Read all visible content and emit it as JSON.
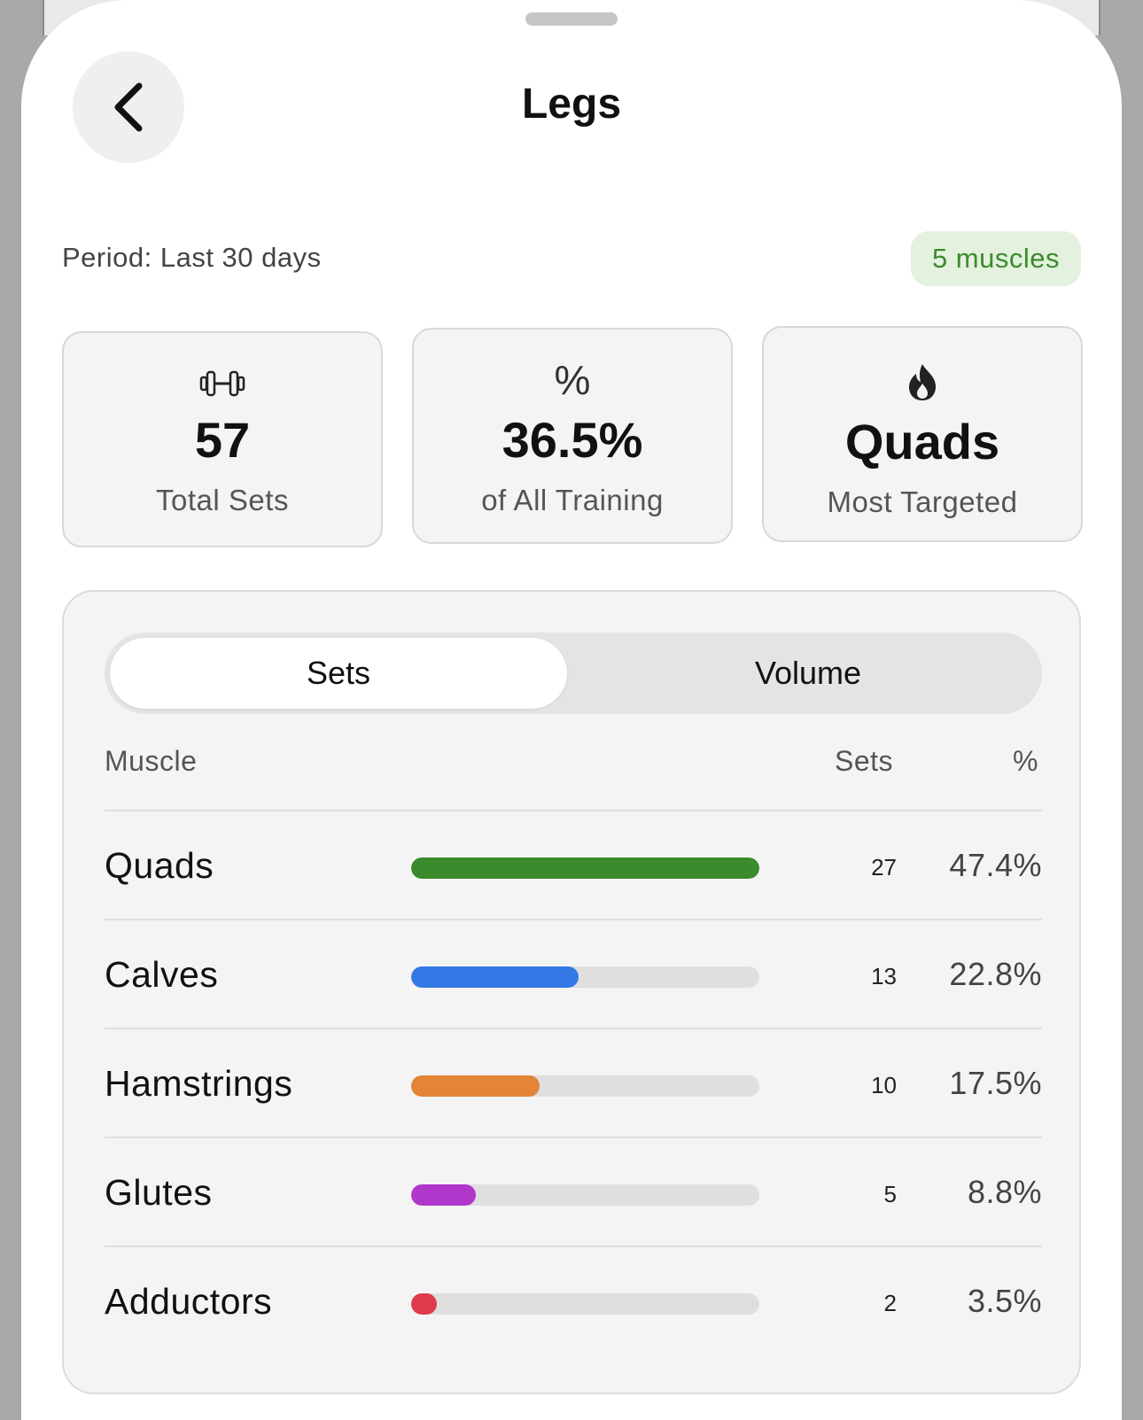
{
  "header": {
    "title": "Legs",
    "back_icon": "chevron-left-icon"
  },
  "summary": {
    "period": "Period: Last 30 days",
    "muscle_count_badge": "5 muscles",
    "badge_color": "#3b8b2c",
    "badge_bg": "#e3f1de"
  },
  "stats": [
    {
      "icon": "dumbbell-icon",
      "value": "57",
      "label": "Total Sets"
    },
    {
      "icon": "percent-icon",
      "icon_glyph": "%",
      "value": "36.5%",
      "label": "of All Training"
    },
    {
      "icon": "flame-icon",
      "value": "Quads",
      "label": "Most Targeted"
    }
  ],
  "toggle": {
    "options": [
      "Sets",
      "Volume"
    ],
    "selected": "Sets"
  },
  "table": {
    "columns": {
      "muscle": "Muscle",
      "sets": "Sets",
      "pct": "%"
    },
    "rows": [
      {
        "name": "Quads",
        "sets": "27",
        "pct": "47.4%",
        "bar_fraction": 1.0,
        "color": "#3b8a2c"
      },
      {
        "name": "Calves",
        "sets": "13",
        "pct": "22.8%",
        "bar_fraction": 0.481,
        "color": "#3478e5"
      },
      {
        "name": "Hamstrings",
        "sets": "10",
        "pct": "17.5%",
        "bar_fraction": 0.37,
        "color": "#e38436"
      },
      {
        "name": "Glutes",
        "sets": "5",
        "pct": "8.8%",
        "bar_fraction": 0.185,
        "color": "#b037cc"
      },
      {
        "name": "Adductors",
        "sets": "2",
        "pct": "3.5%",
        "bar_fraction": 0.074,
        "color": "#df3a4a"
      }
    ]
  }
}
